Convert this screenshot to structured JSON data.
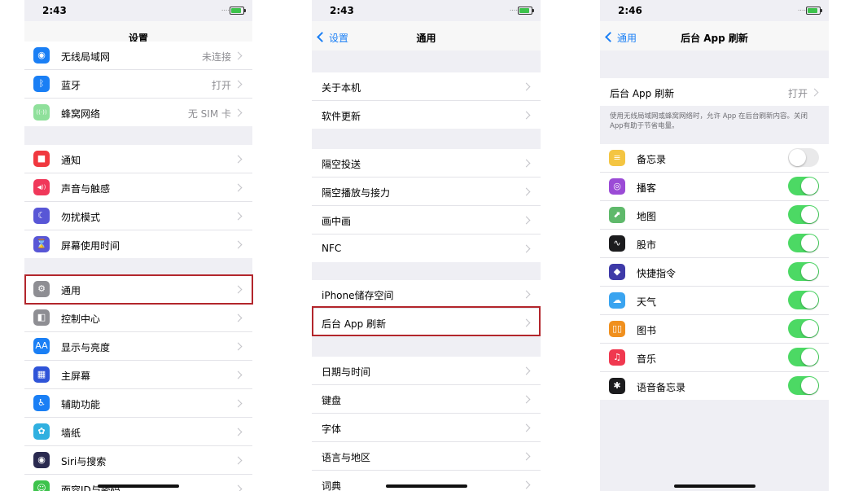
{
  "screen_settings": {
    "time": "2:43",
    "signal": "....",
    "title": "设置",
    "group_network": [
      {
        "label": "无线局域网",
        "value": "未连接",
        "icon": "wifi-icon",
        "color": "#1a7ff5",
        "glyph": "◉"
      },
      {
        "label": "蓝牙",
        "value": "打开",
        "icon": "bluetooth-icon",
        "color": "#1a7ff5",
        "glyph": "ᛒ"
      },
      {
        "label": "蜂窝网络",
        "value": "无 SIM 卡",
        "icon": "cellular-icon",
        "color": "#8fe09b",
        "glyph": "((·))"
      }
    ],
    "group_notify": [
      {
        "label": "通知",
        "icon": "notification-icon",
        "color": "#f0383f",
        "glyph": "■"
      },
      {
        "label": "声音与触感",
        "icon": "sound-icon",
        "color": "#f0385a",
        "glyph": "◀))"
      },
      {
        "label": "勿扰模式",
        "icon": "moon-icon",
        "color": "#5856d6",
        "glyph": "☾"
      },
      {
        "label": "屏幕使用时间",
        "icon": "hourglass-icon",
        "color": "#5856d6",
        "glyph": "⌛"
      }
    ],
    "group_general": [
      {
        "label": "通用",
        "icon": "gear-icon",
        "color": "#8e8e93",
        "glyph": "⚙"
      },
      {
        "label": "控制中心",
        "icon": "control-center-icon",
        "color": "#8e8e93",
        "glyph": "◧"
      },
      {
        "label": "显示与亮度",
        "icon": "display-icon",
        "color": "#1a7ff5",
        "glyph": "AA"
      },
      {
        "label": "主屏幕",
        "icon": "home-screen-icon",
        "color": "#2f54d8",
        "glyph": "▦"
      },
      {
        "label": "辅助功能",
        "icon": "accessibility-icon",
        "color": "#1a7ff5",
        "glyph": "♿"
      },
      {
        "label": "墙纸",
        "icon": "wallpaper-icon",
        "color": "#30b0e0",
        "glyph": "✿"
      },
      {
        "label": "Siri与搜索",
        "icon": "siri-icon",
        "color": "#2a2a50",
        "glyph": "◉"
      },
      {
        "label": "面容ID与密码",
        "icon": "faceid-icon",
        "color": "#3dc34c",
        "glyph": "☺"
      }
    ]
  },
  "screen_general": {
    "time": "2:43",
    "signal": "....",
    "back_label": "设置",
    "title": "通用",
    "group1": [
      "关于本机",
      "软件更新"
    ],
    "group2": [
      "隔空投送",
      "隔空播放与接力",
      "画中画",
      "NFC"
    ],
    "group3": [
      "iPhone储存空间",
      "后台 App 刷新"
    ],
    "group4": [
      "日期与时间",
      "键盘",
      "字体",
      "语言与地区",
      "词典"
    ]
  },
  "screen_refresh": {
    "time": "2:46",
    "signal": "....",
    "back_label": "通用",
    "title": "后台 App 刷新",
    "main_label": "后台 App 刷新",
    "main_value": "打开",
    "description": "使用无线局域网或蜂窝网络时，允许 App 在后台刷新内容。关闭App有助于节省电量。",
    "apps": [
      {
        "label": "备忘录",
        "on": false,
        "icon": "notes-icon",
        "color": "#f4c542",
        "glyph": "≡"
      },
      {
        "label": "播客",
        "on": true,
        "icon": "podcasts-icon",
        "color": "#9b4bd6",
        "glyph": "◎"
      },
      {
        "label": "地图",
        "on": true,
        "icon": "maps-icon",
        "color": "#5fb96b",
        "glyph": "⬈"
      },
      {
        "label": "股市",
        "on": true,
        "icon": "stocks-icon",
        "color": "#1c1c1e",
        "glyph": "∿"
      },
      {
        "label": "快捷指令",
        "on": true,
        "icon": "shortcuts-icon",
        "color": "#3e3aa8",
        "glyph": "◆"
      },
      {
        "label": "天气",
        "on": true,
        "icon": "weather-icon",
        "color": "#3aa4f0",
        "glyph": "☁"
      },
      {
        "label": "图书",
        "on": true,
        "icon": "books-icon",
        "color": "#f0901e",
        "glyph": "▯▯"
      },
      {
        "label": "音乐",
        "on": true,
        "icon": "music-icon",
        "color": "#f0384f",
        "glyph": "♫"
      },
      {
        "label": "语音备忘录",
        "on": true,
        "icon": "voice-memos-icon",
        "color": "#1c1c1e",
        "glyph": "✱"
      }
    ]
  }
}
